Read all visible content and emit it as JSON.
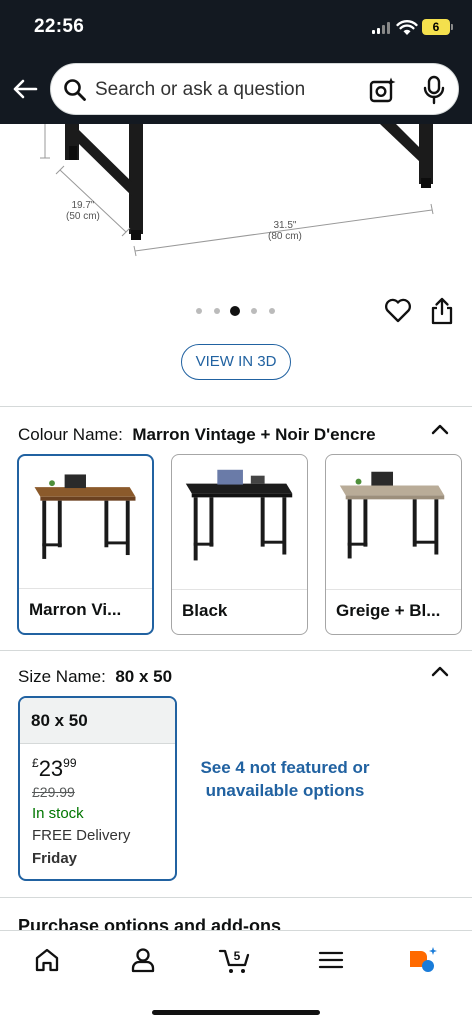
{
  "status_bar": {
    "time": "22:56",
    "battery": "6"
  },
  "search": {
    "placeholder": "Search or ask a question"
  },
  "product_image": {
    "dim_depth": "19.7\"",
    "dim_depth_cm": "(50 cm)",
    "dim_width": "31.5\"",
    "dim_width_cm": "(80 cm)"
  },
  "carousel": {
    "count": 5,
    "active_index": 2
  },
  "view_3d_label": "VIEW IN 3D",
  "colour": {
    "label": "Colour Name:",
    "value": "Marron Vintage + Noir D'encre",
    "options": [
      {
        "label": "Marron Vi...",
        "top_color": "#8b5a2b",
        "frame_color": "#1a1a1a"
      },
      {
        "label": "Black",
        "top_color": "#1c1c1c",
        "frame_color": "#1a1a1a"
      },
      {
        "label": "Greige + Bl...",
        "top_color": "#b9ac98",
        "frame_color": "#1a1a1a"
      }
    ]
  },
  "size": {
    "label": "Size Name:",
    "value": "80 x 50",
    "card": {
      "name": "80 x 50",
      "currency": "£",
      "price_whole": "23",
      "price_fraction": "99",
      "was_price": "£29.99",
      "stock": "In stock",
      "delivery": "FREE Delivery",
      "day": "Friday"
    },
    "see_more": "See 4 not featured or unavailable options"
  },
  "purchase_heading": "Purchase options and add-ons",
  "bottom_nav": {
    "cart_count": "5"
  },
  "colors": {
    "link_blue": "#2162a1",
    "in_stock_green": "#007600",
    "header_bg": "#131921",
    "rufus_orange": "#ff6a00",
    "rufus_blue": "#1a7cd9"
  }
}
